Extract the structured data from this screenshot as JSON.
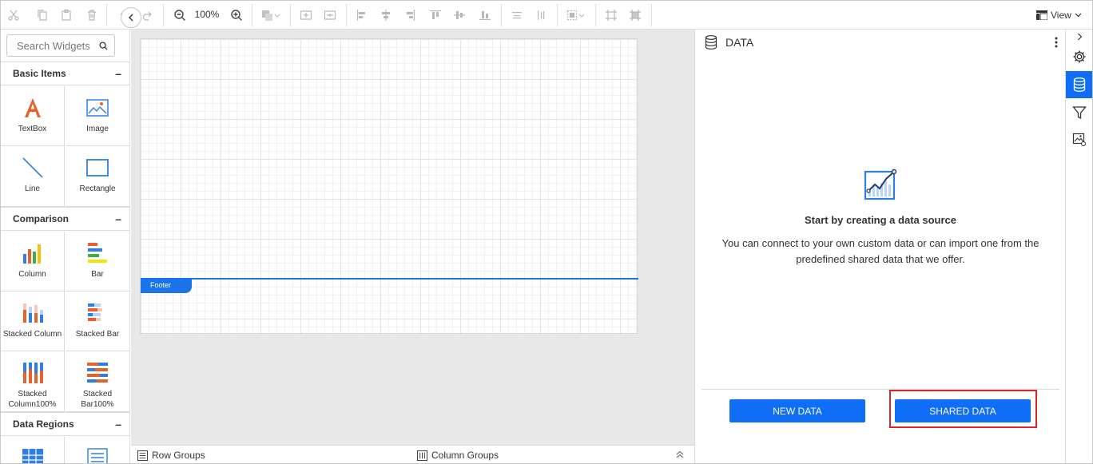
{
  "toolbar": {
    "zoom_level": "100%",
    "view_label": "View"
  },
  "left_panel": {
    "search_placeholder": "Search Widgets",
    "sections": {
      "basic": {
        "title": "Basic Items",
        "items": [
          "TextBox",
          "Image",
          "Line",
          "Rectangle"
        ]
      },
      "comparison": {
        "title": "Comparison",
        "items": [
          "Column",
          "Bar",
          "Stacked Column",
          "Stacked Bar",
          "Stacked Column100%",
          "Stacked Bar100%"
        ]
      },
      "data_regions": {
        "title": "Data Regions"
      }
    }
  },
  "canvas": {
    "footer_label": "Footer"
  },
  "bottom_bar": {
    "row_groups": "Row Groups",
    "column_groups": "Column Groups"
  },
  "data_panel": {
    "title": "DATA",
    "empty_title": "Start by creating a data source",
    "empty_desc": "You can connect to your own custom data or can import one from the predefined shared data that we offer.",
    "new_data_label": "NEW DATA",
    "shared_data_label": "SHARED DATA"
  },
  "colors": {
    "accent": "#0f6ef5",
    "highlight": "#d9242b",
    "footer": "#1a73e8"
  }
}
